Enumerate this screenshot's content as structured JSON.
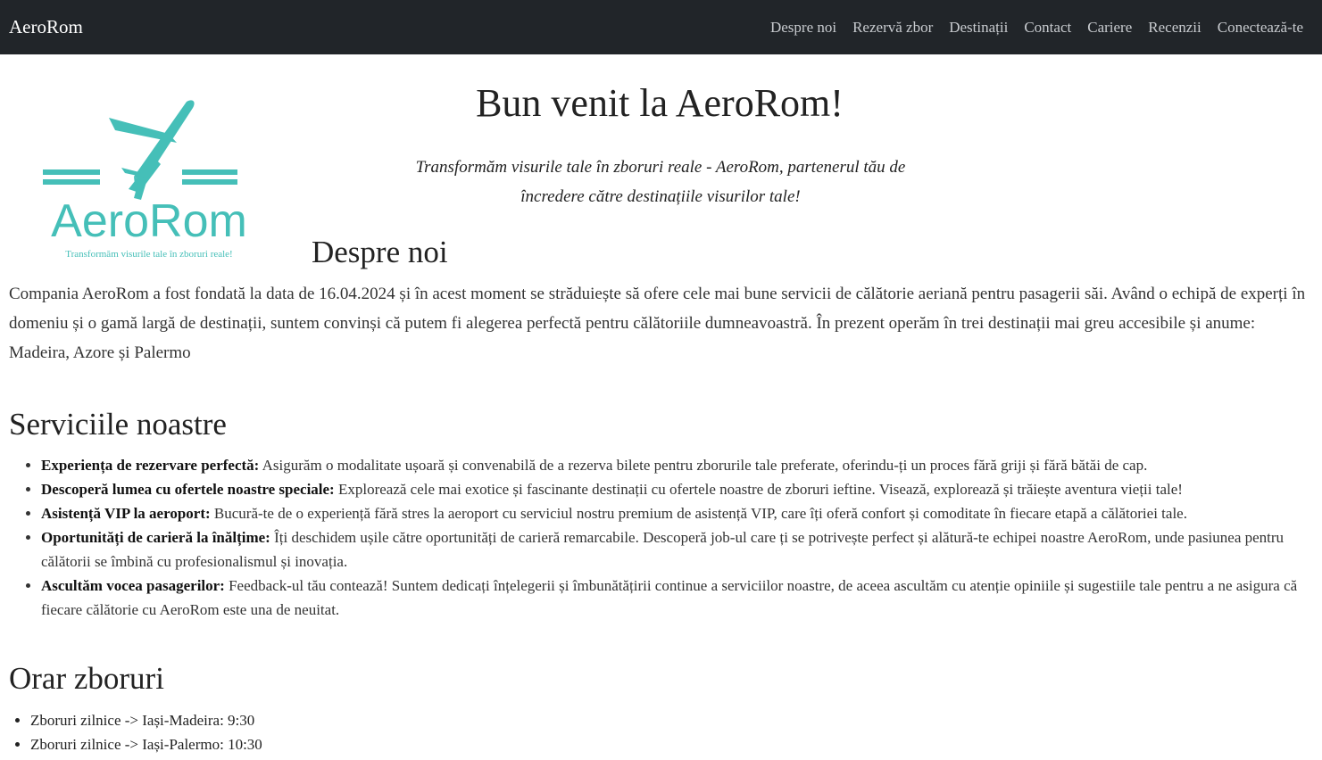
{
  "navbar": {
    "brand": "AeroRom",
    "links": [
      "Despre noi",
      "Rezervă zbor",
      "Destinații",
      "Contact",
      "Cariere",
      "Recenzii",
      "Conectează-te"
    ]
  },
  "logo": {
    "text": "AeroRom",
    "subtitle": "Transformăm visurile tale în zboruri reale!",
    "color": "#45bfb8"
  },
  "hero": {
    "title": "Bun venit la AeroRom!",
    "tagline_line1": "Transformăm visurile tale în zboruri reale - AeroRom, partenerul tău de",
    "tagline_line2": "încredere către destinațiile visurilor tale!"
  },
  "about": {
    "title": "Despre noi",
    "text": "Compania AeroRom a fost fondată la data de 16.04.2024 și în acest moment se străduiește să ofere cele mai bune servicii de călătorie aeriană pentru pasagerii săi. Având o echipă de experți în domeniu și o gamă largă de destinații, suntem convinși că putem fi alegerea perfectă pentru călătoriile dumneavoastră. În prezent operăm în trei destinații mai greu accesibile și anume: Madeira, Azore și Palermo"
  },
  "services": {
    "title": "Serviciile noastre",
    "items": [
      {
        "bold": "Experiența de rezervare perfectă:",
        "text": " Asigurăm o modalitate ușoară și convenabilă de a rezerva bilete pentru zborurile tale preferate, oferindu-ți un proces fără griji și fără bătăi de cap."
      },
      {
        "bold": "Descoperă lumea cu ofertele noastre speciale:",
        "text": " Explorează cele mai exotice și fascinante destinații cu ofertele noastre de zboruri ieftine. Visează, explorează și trăiește aventura vieții tale!"
      },
      {
        "bold": "Asistență VIP la aeroport:",
        "text": " Bucură-te de o experiență fără stres la aeroport cu serviciul nostru premium de asistență VIP, care îți oferă confort și comoditate în fiecare etapă a călătoriei tale."
      },
      {
        "bold": "Oportunități de carieră la înălțime:",
        "text": " Îți deschidem ușile către oportunități de carieră remarcabile. Descoperă job-ul care ți se potrivește perfect și alătură-te echipei noastre AeroRom, unde pasiunea pentru călătorii se îmbină cu profesionalismul și inovația."
      },
      {
        "bold": "Ascultăm vocea pasagerilor:",
        "text": " Feedback-ul tău contează! Suntem dedicați înțelegerii și îmbunătățirii continue a serviciilor noastre, de aceea ascultăm cu atenție opiniile și sugestiile tale pentru a ne asigura că fiecare călătorie cu AeroRom este una de neuitat."
      }
    ]
  },
  "schedule": {
    "title": "Orar zboruri",
    "items": [
      "Zboruri zilnice -> Iași-Madeira: 9:30",
      "Zboruri zilnice -> Iași-Palermo: 10:30"
    ]
  }
}
